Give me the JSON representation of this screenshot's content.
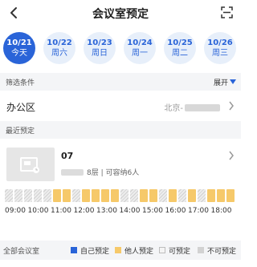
{
  "header": {
    "title": "会议室预定"
  },
  "dates": [
    {
      "date": "10/21",
      "weekday": "今天",
      "active": true
    },
    {
      "date": "10/22",
      "weekday": "周六",
      "active": false
    },
    {
      "date": "10/23",
      "weekday": "周日",
      "active": false
    },
    {
      "date": "10/24",
      "weekday": "周一",
      "active": false
    },
    {
      "date": "10/25",
      "weekday": "周二",
      "active": false
    },
    {
      "date": "10/26",
      "weekday": "周三",
      "active": false
    }
  ],
  "filter": {
    "label": "筛选条件",
    "expand_label": "展开"
  },
  "office": {
    "label": "办公区",
    "value": "北京-"
  },
  "recent": {
    "label": "最近预定"
  },
  "room": {
    "name": "07",
    "info": "8层 | 可容纳6人",
    "slots": [
      "hatched",
      "hatched",
      "hatched",
      "hatched",
      "hatched",
      "other",
      "other",
      "hatched",
      "other",
      "other",
      "other",
      "other",
      "hatched",
      "hatched",
      "other",
      "other",
      "hatched",
      "other",
      "hatched",
      "other",
      "hatched",
      "other",
      "other",
      "other"
    ],
    "times": [
      "09:00",
      "10:00",
      "11:00",
      "12:00",
      "13:00",
      "14:00",
      "15:00",
      "16:00",
      "17:00",
      "18:00"
    ]
  },
  "legend": {
    "label": "全部会议室",
    "items": [
      {
        "label": "自己预定",
        "color": "#2a64d8"
      },
      {
        "label": "他人预定",
        "color": "#f6c96a"
      },
      {
        "label": "可预定",
        "color": "#f4f4f4"
      },
      {
        "label": "不可预定",
        "color": "#d2d2d2"
      }
    ]
  }
}
